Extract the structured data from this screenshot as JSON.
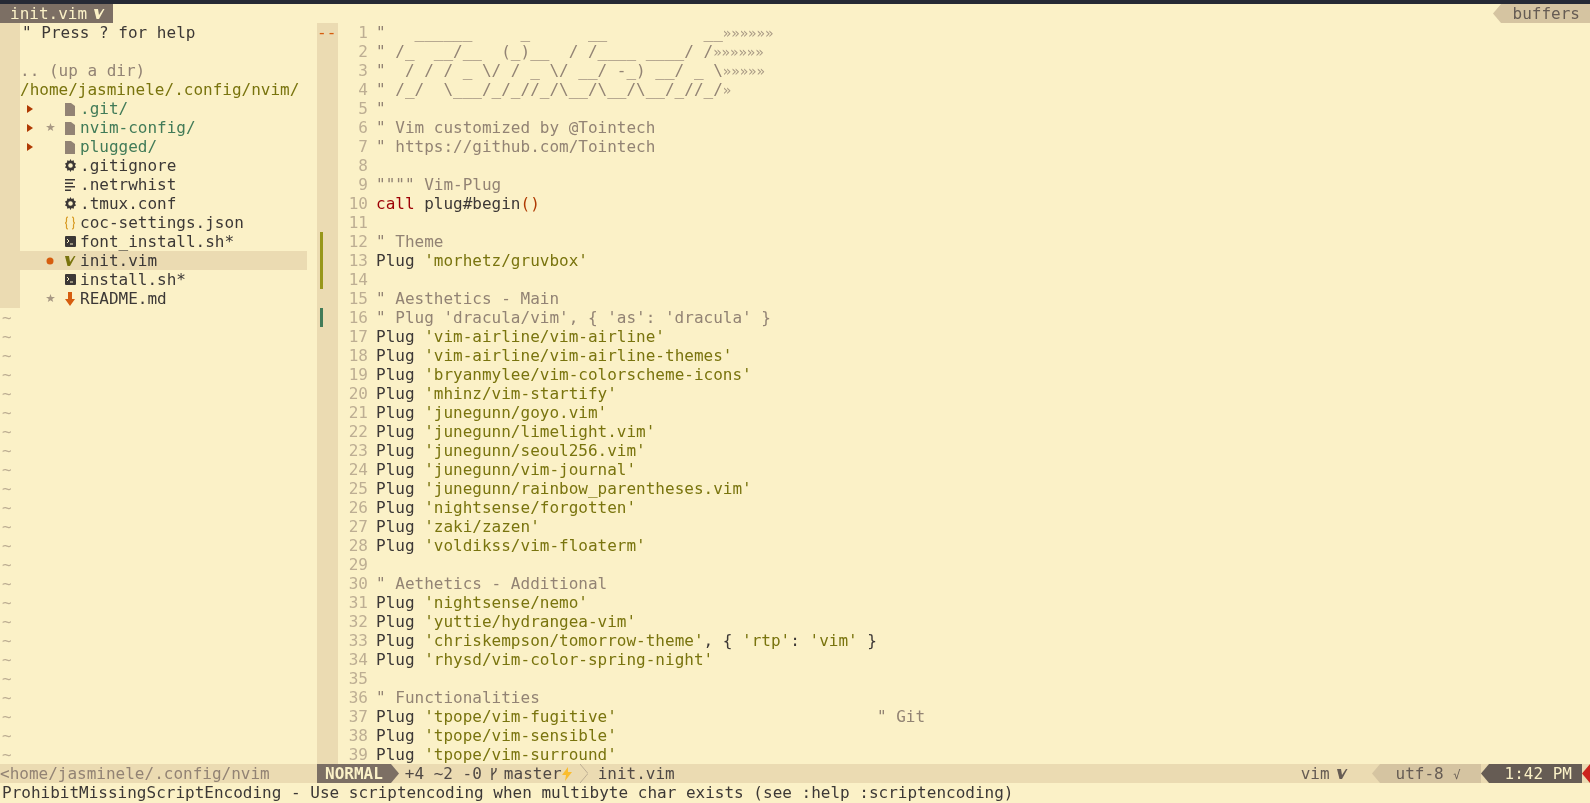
{
  "tabline": {
    "tab": "init.vim",
    "buffers_label": "buffers"
  },
  "explorer": {
    "help": "\" Press ? for help",
    "up": ".. (up a dir)",
    "path": "/home/jasminele/.config/nvim/",
    "items": [
      {
        "collapsed": true,
        "starred": false,
        "modified": false,
        "kind": "folder",
        "name": ".git/",
        "selected": false
      },
      {
        "collapsed": true,
        "starred": true,
        "modified": false,
        "kind": "folder",
        "name": "nvim-config/",
        "selected": false
      },
      {
        "collapsed": true,
        "starred": false,
        "modified": false,
        "kind": "folder",
        "name": "plugged/",
        "selected": false
      },
      {
        "collapsed": false,
        "starred": false,
        "modified": false,
        "kind": "config",
        "name": ".gitignore",
        "selected": false
      },
      {
        "collapsed": false,
        "starred": false,
        "modified": false,
        "kind": "text",
        "name": ".netrwhist",
        "selected": false
      },
      {
        "collapsed": false,
        "starred": false,
        "modified": false,
        "kind": "config",
        "name": ".tmux.conf",
        "selected": false
      },
      {
        "collapsed": false,
        "starred": false,
        "modified": false,
        "kind": "json",
        "name": "coc-settings.json",
        "selected": false
      },
      {
        "collapsed": false,
        "starred": false,
        "modified": false,
        "kind": "script",
        "name": "font_install.sh*",
        "selected": false
      },
      {
        "collapsed": false,
        "starred": false,
        "modified": true,
        "kind": "vim",
        "name": "init.vim",
        "selected": true
      },
      {
        "collapsed": false,
        "starred": false,
        "modified": false,
        "kind": "script",
        "name": "install.sh*",
        "selected": false
      },
      {
        "collapsed": false,
        "starred": true,
        "modified": false,
        "kind": "readme",
        "name": "README.md",
        "selected": false
      }
    ],
    "tildes": [
      "~",
      "~",
      "~",
      "~",
      "~",
      "~",
      "~",
      "~",
      "~",
      "~",
      "~",
      "~",
      "~",
      "~",
      "~",
      "~",
      "~",
      "~",
      "~",
      "~",
      "~",
      "~",
      "~",
      "~"
    ]
  },
  "editor": {
    "lines": [
      {
        "n": "1",
        "sign": {
          "kind": "text",
          "text": "--"
        },
        "trail": "»»»»»»",
        "segs": [
          {
            "kind": "comment",
            "text": "\"   ______     _      __          __"
          }
        ]
      },
      {
        "n": "2",
        "trail": "»»»»»»",
        "segs": [
          {
            "kind": "comment",
            "text": "\" /_  __/__  (_)__  / /____ ____/ /"
          }
        ]
      },
      {
        "n": "3",
        "trail": "»»»»»",
        "segs": [
          {
            "kind": "comment",
            "text": "\"  / / / _ \\/ / _ \\/ __/ -_) __/ _ \\"
          }
        ]
      },
      {
        "n": "4",
        "trail": "»",
        "segs": [
          {
            "kind": "comment",
            "text": "\" /_/  \\___/_/_//_/\\__/\\__/\\__/_//_/"
          }
        ]
      },
      {
        "n": "5",
        "segs": [
          {
            "kind": "comment",
            "text": "\""
          }
        ]
      },
      {
        "n": "6",
        "segs": [
          {
            "kind": "comment",
            "text": "\" Vim customized by @Tointech"
          }
        ]
      },
      {
        "n": "7",
        "segs": [
          {
            "kind": "comment",
            "text": "\" https://github.com/Tointech"
          }
        ]
      },
      {
        "n": "8"
      },
      {
        "n": "9",
        "segs": [
          {
            "kind": "comment",
            "text": "\"\"\"\" Vim-Plug"
          }
        ]
      },
      {
        "n": "10",
        "segs": [
          {
            "kind": "call",
            "text": "call"
          },
          {
            "kind": "plain",
            "text": " plug#begin"
          },
          {
            "kind": "paren",
            "text": "()"
          }
        ]
      },
      {
        "n": "11"
      },
      {
        "n": "12",
        "sign": {
          "kind": "changed"
        },
        "segs": [
          {
            "kind": "comment",
            "text": "\" Theme"
          }
        ]
      },
      {
        "n": "13",
        "sign": {
          "kind": "changed"
        },
        "segs": [
          {
            "kind": "plain",
            "text": "Plug "
          },
          {
            "kind": "string",
            "text": "'morhetz/gruvbox'"
          }
        ]
      },
      {
        "n": "14",
        "sign": {
          "kind": "changed"
        }
      },
      {
        "n": "15",
        "segs": [
          {
            "kind": "comment",
            "text": "\" Aesthetics - Main"
          }
        ]
      },
      {
        "n": "16",
        "sign": {
          "kind": "added"
        },
        "segs": [
          {
            "kind": "comment",
            "text": "\" Plug 'dracula/vim', { 'as': 'dracula' }"
          }
        ]
      },
      {
        "n": "17",
        "segs": [
          {
            "kind": "plain",
            "text": "Plug "
          },
          {
            "kind": "string",
            "text": "'vim-airline/vim-airline'"
          }
        ]
      },
      {
        "n": "18",
        "segs": [
          {
            "kind": "plain",
            "text": "Plug "
          },
          {
            "kind": "string",
            "text": "'vim-airline/vim-airline-themes'"
          }
        ]
      },
      {
        "n": "19",
        "segs": [
          {
            "kind": "plain",
            "text": "Plug "
          },
          {
            "kind": "string",
            "text": "'bryanmylee/vim-colorscheme-icons'"
          }
        ]
      },
      {
        "n": "20",
        "segs": [
          {
            "kind": "plain",
            "text": "Plug "
          },
          {
            "kind": "string",
            "text": "'mhinz/vim-startify'"
          }
        ]
      },
      {
        "n": "21",
        "segs": [
          {
            "kind": "plain",
            "text": "Plug "
          },
          {
            "kind": "string",
            "text": "'junegunn/goyo.vim'"
          }
        ]
      },
      {
        "n": "22",
        "segs": [
          {
            "kind": "plain",
            "text": "Plug "
          },
          {
            "kind": "string",
            "text": "'junegunn/limelight.vim'"
          }
        ]
      },
      {
        "n": "23",
        "segs": [
          {
            "kind": "plain",
            "text": "Plug "
          },
          {
            "kind": "string",
            "text": "'junegunn/seoul256.vim'"
          }
        ]
      },
      {
        "n": "24",
        "segs": [
          {
            "kind": "plain",
            "text": "Plug "
          },
          {
            "kind": "string",
            "text": "'junegunn/vim-journal'"
          }
        ]
      },
      {
        "n": "25",
        "segs": [
          {
            "kind": "plain",
            "text": "Plug "
          },
          {
            "kind": "string",
            "text": "'junegunn/rainbow_parentheses.vim'"
          }
        ]
      },
      {
        "n": "26",
        "segs": [
          {
            "kind": "plain",
            "text": "Plug "
          },
          {
            "kind": "string",
            "text": "'nightsense/forgotten'"
          }
        ]
      },
      {
        "n": "27",
        "segs": [
          {
            "kind": "plain",
            "text": "Plug "
          },
          {
            "kind": "string",
            "text": "'zaki/zazen'"
          }
        ]
      },
      {
        "n": "28",
        "segs": [
          {
            "kind": "plain",
            "text": "Plug "
          },
          {
            "kind": "string",
            "text": "'voldikss/vim-floaterm'"
          }
        ]
      },
      {
        "n": "29"
      },
      {
        "n": "30",
        "segs": [
          {
            "kind": "comment",
            "text": "\" Aethetics - Additional"
          }
        ]
      },
      {
        "n": "31",
        "segs": [
          {
            "kind": "plain",
            "text": "Plug "
          },
          {
            "kind": "string",
            "text": "'nightsense/nemo'"
          }
        ]
      },
      {
        "n": "32",
        "segs": [
          {
            "kind": "plain",
            "text": "Plug "
          },
          {
            "kind": "string",
            "text": "'yuttie/hydrangea-vim'"
          }
        ]
      },
      {
        "n": "33",
        "segs": [
          {
            "kind": "plain",
            "text": "Plug "
          },
          {
            "kind": "string",
            "text": "'chriskempson/tomorrow-theme'"
          },
          {
            "kind": "plain",
            "text": ", { "
          },
          {
            "kind": "string",
            "text": "'rtp'"
          },
          {
            "kind": "plain",
            "text": ": "
          },
          {
            "kind": "string",
            "text": "'vim'"
          },
          {
            "kind": "plain",
            "text": " }"
          }
        ]
      },
      {
        "n": "34",
        "segs": [
          {
            "kind": "plain",
            "text": "Plug "
          },
          {
            "kind": "string",
            "text": "'rhysd/vim-color-spring-night'"
          }
        ]
      },
      {
        "n": "35"
      },
      {
        "n": "36",
        "segs": [
          {
            "kind": "comment",
            "text": "\" Functionalities"
          }
        ]
      },
      {
        "n": "37",
        "segs": [
          {
            "kind": "plain",
            "text": "Plug "
          },
          {
            "kind": "string",
            "text": "'tpope/vim-fugitive'"
          },
          {
            "kind": "aside_comment",
            "text": "\" Git"
          }
        ]
      },
      {
        "n": "38",
        "segs": [
          {
            "kind": "plain",
            "text": "Plug "
          },
          {
            "kind": "string",
            "text": "'tpope/vim-sensible'"
          }
        ]
      },
      {
        "n": "39",
        "segs": [
          {
            "kind": "plain",
            "text": "Plug "
          },
          {
            "kind": "string",
            "text": "'tpope/vim-surround'"
          }
        ]
      }
    ]
  },
  "status_bar": {
    "path": "<home/jasminele/.config/nvim",
    "mode": "NORMAL",
    "hunks": "+4 ~2 -0",
    "branch": "master",
    "file": "init.vim",
    "filetype": "vim",
    "encoding": "utf-8",
    "format_mark": "√",
    "time": "1:42 PM"
  },
  "command_line": "ProhibitMissingScriptEncoding - Use scriptencoding when multibyte char exists (see :help :scriptencoding)"
}
